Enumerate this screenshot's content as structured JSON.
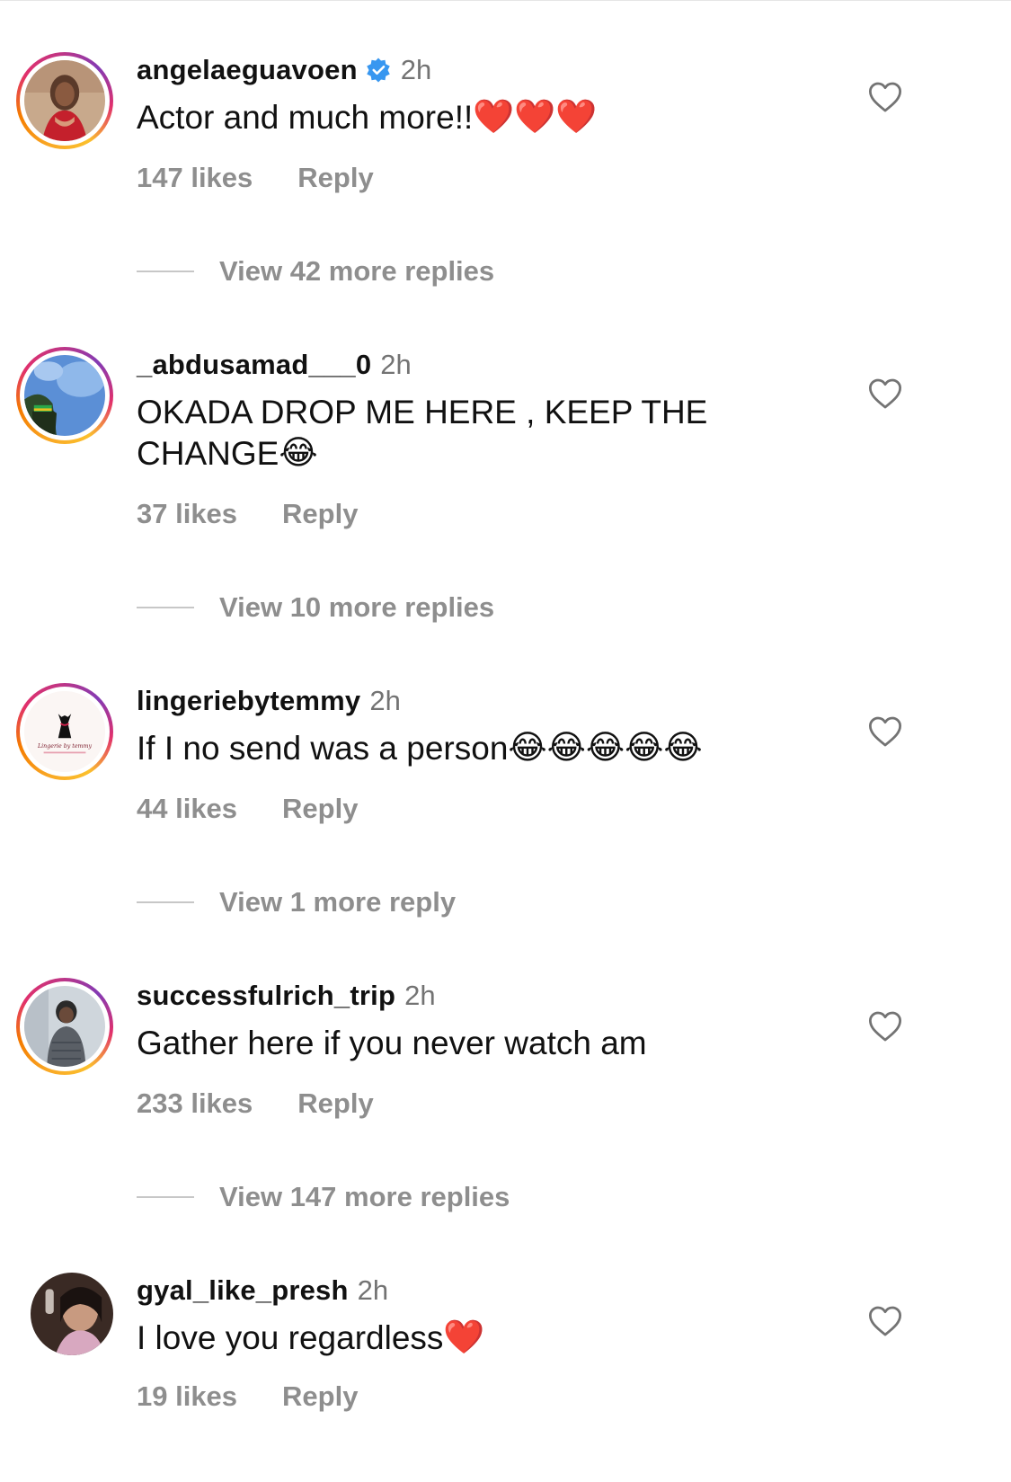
{
  "comments": [
    {
      "username": "angelaeguavoen",
      "verified": true,
      "time": "2h",
      "text": "Actor and much more!!",
      "emojis": [
        "❤️",
        "❤️",
        "❤️"
      ],
      "likes": "147 likes",
      "reply": "Reply",
      "view_replies": "View 42 more replies"
    },
    {
      "username": "_abdusamad___0",
      "time": "2h",
      "text_line1": "OKADA DROP ME HERE , KEEP THE",
      "text_line2": "CHANGE",
      "emojis": [
        "😂"
      ],
      "likes": "37 likes",
      "reply": "Reply",
      "view_replies": "View 10 more replies"
    },
    {
      "username": "lingeriebytemmy",
      "time": "2h",
      "text": "If I no send was a person",
      "emojis": [
        "😂",
        "😂",
        "😂",
        "😂",
        "😂"
      ],
      "avatar_logo_text": "Lingerie by temmy",
      "likes": "44 likes",
      "reply": "Reply",
      "view_replies": "View 1 more reply"
    },
    {
      "username": "successfulrich_trip",
      "time": "2h",
      "text": "Gather here if you never watch am",
      "likes": "233 likes",
      "reply": "Reply",
      "view_replies": "View 147 more replies"
    },
    {
      "username": "gyal_like_presh",
      "time": "2h",
      "text": "I love you regardless",
      "emojis": [
        "❤️"
      ],
      "likes": "19 likes",
      "reply": "Reply"
    }
  ],
  "icons": {
    "heart": "heart-outline-icon",
    "verified": "verified-badge-icon"
  },
  "colors": {
    "username": "#111111",
    "meta": "#8e8e8e",
    "time": "#737373",
    "verified": "#3897f0"
  }
}
